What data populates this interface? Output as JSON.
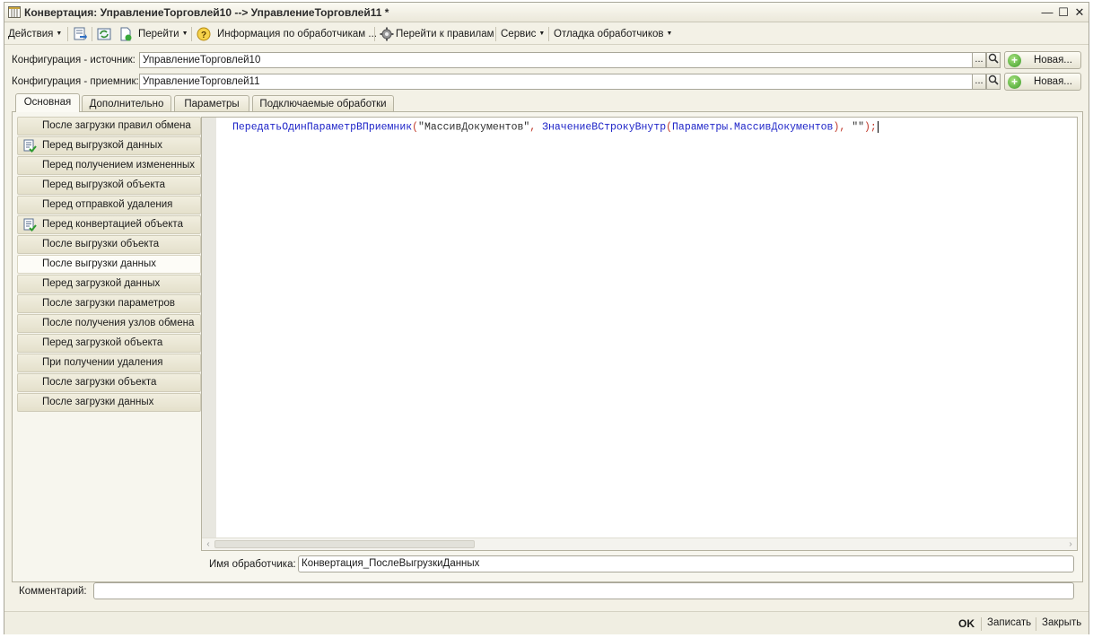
{
  "window": {
    "title": "Конвертация: УправлениеТорговлей10 --> УправлениеТорговлей11 *",
    "minimize_glyph": "—",
    "maximize_glyph": "☐",
    "close_glyph": "✕"
  },
  "toolbar": {
    "actions": "Действия",
    "goto": "Перейти",
    "handlers_info": "Информация по обработчикам ...",
    "goto_rules": "Перейти к правилам",
    "service": "Сервис",
    "debug": "Отладка обработчиков"
  },
  "config": {
    "source_label": "Конфигурация - источник:",
    "source_value": "УправлениеТорговлей10",
    "target_label": "Конфигурация - приемник:",
    "target_value": "УправлениеТорговлей11",
    "select_glyph": "...",
    "new_label": "Новая..."
  },
  "tabs": [
    {
      "label": "Основная",
      "active": true
    },
    {
      "label": "Дополнительно",
      "active": false
    },
    {
      "label": "Параметры",
      "active": false
    },
    {
      "label": "Подключаемые обработки",
      "active": false
    }
  ],
  "events": [
    {
      "label": "После загрузки правил обмена",
      "has_code": false,
      "selected": false
    },
    {
      "label": "Перед выгрузкой данных",
      "has_code": true,
      "selected": false
    },
    {
      "label": "Перед получением измененных",
      "has_code": false,
      "selected": false
    },
    {
      "label": "Перед выгрузкой объекта",
      "has_code": false,
      "selected": false
    },
    {
      "label": "Перед отправкой удаления",
      "has_code": false,
      "selected": false
    },
    {
      "label": "Перед конвертацией объекта",
      "has_code": true,
      "selected": false
    },
    {
      "label": "После выгрузки объекта",
      "has_code": false,
      "selected": false
    },
    {
      "label": "После выгрузки данных",
      "has_code": false,
      "selected": true
    },
    {
      "label": "Перед загрузкой данных",
      "has_code": false,
      "selected": false
    },
    {
      "label": "После загрузки параметров",
      "has_code": false,
      "selected": false
    },
    {
      "label": "После получения узлов обмена",
      "has_code": false,
      "selected": false
    },
    {
      "label": "Перед загрузкой объекта",
      "has_code": false,
      "selected": false
    },
    {
      "label": "При получении удаления",
      "has_code": false,
      "selected": false
    },
    {
      "label": "После загрузки объекта",
      "has_code": false,
      "selected": false
    },
    {
      "label": "После загрузки данных",
      "has_code": false,
      "selected": false
    }
  ],
  "code": {
    "fn1": "ПередатьОдинПараметрВПриемник",
    "p1": "(",
    "s1": "\"МассивДокументов\"",
    "c1": ", ",
    "fn2": "ЗначениеВСтрокуВнутр",
    "p2": "(",
    "arg": "Параметры.МассивДокументов",
    "p3": ")",
    "c2": ", ",
    "s2": "\"\"",
    "end": ");"
  },
  "handler": {
    "label": "Имя обработчика:",
    "value": "Конвертация_ПослеВыгрузкиДанных"
  },
  "comment": {
    "label": "Комментарий:",
    "value": ""
  },
  "bottom": {
    "ok": "OK",
    "save": "Записать",
    "close": "Закрыть"
  }
}
